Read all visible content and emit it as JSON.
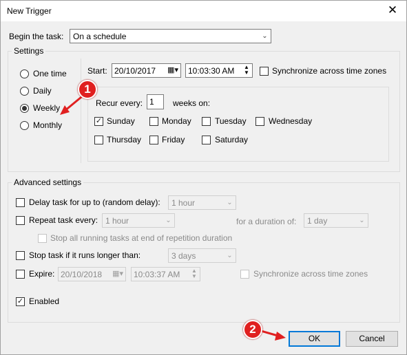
{
  "window": {
    "title": "New Trigger",
    "close_glyph": "✕"
  },
  "begin": {
    "label": "Begin the task:",
    "value": "On a schedule"
  },
  "settings": {
    "legend": "Settings",
    "schedule_options": [
      "One time",
      "Daily",
      "Weekly",
      "Monthly"
    ],
    "selected": "Weekly",
    "start_label": "Start:",
    "start_date": "20/10/2017",
    "start_time": "10:03:30 AM",
    "sync_label": "Synchronize across time zones",
    "recur_label": "Recur every:",
    "recur_value": "1",
    "weeks_on": "weeks on:",
    "days": {
      "sunday": "Sunday",
      "monday": "Monday",
      "tuesday": "Tuesday",
      "wednesday": "Wednesday",
      "thursday": "Thursday",
      "friday": "Friday",
      "saturday": "Saturday"
    },
    "checked_days": [
      "Sunday"
    ]
  },
  "advanced": {
    "legend": "Advanced settings",
    "delay_label": "Delay task for up to (random delay):",
    "delay_value": "1 hour",
    "repeat_label": "Repeat task every:",
    "repeat_value": "1 hour",
    "duration_label": "for a duration of:",
    "duration_value": "1 day",
    "stop_running_label": "Stop all running tasks at end of repetition duration",
    "stop_longer_label": "Stop task if it runs longer than:",
    "stop_longer_value": "3 days",
    "expire_label": "Expire:",
    "expire_date": "20/10/2018",
    "expire_time": "10:03:37 AM",
    "expire_sync_label": "Synchronize across time zones",
    "enabled_label": "Enabled",
    "enabled_checked": true
  },
  "buttons": {
    "ok": "OK",
    "cancel": "Cancel"
  },
  "annotations": {
    "step1": "1",
    "step2": "2"
  },
  "colors": {
    "annotation_red": "#e02020",
    "default_button_border": "#0078d7"
  }
}
